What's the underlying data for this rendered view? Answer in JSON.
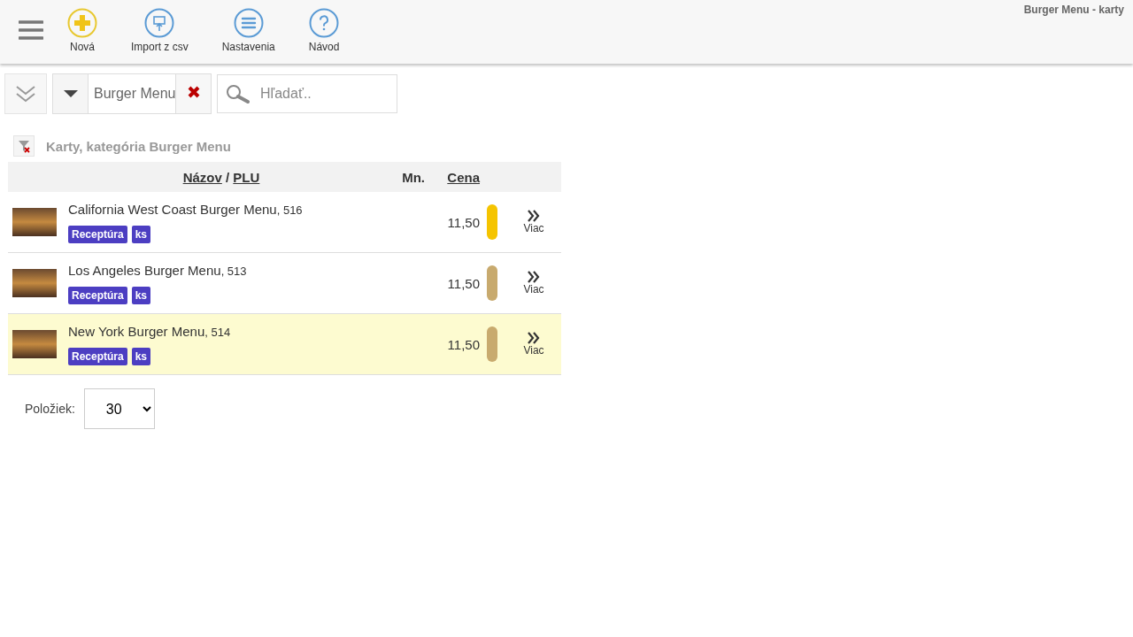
{
  "window": {
    "title": "Burger Menu - karty"
  },
  "toolbar": [
    {
      "kind": "add",
      "label": "Nová"
    },
    {
      "kind": "import",
      "label": "Import z csv"
    },
    {
      "kind": "settings",
      "label": "Nastavenia"
    },
    {
      "kind": "help",
      "label": "Návod"
    }
  ],
  "filter": {
    "category": "Burger Menu",
    "search_placeholder": "Hľadať.."
  },
  "heading": "Karty, kategória Burger Menu",
  "table": {
    "columns": {
      "name": "Názov",
      "separator": "/",
      "plu": "PLU",
      "qty": "Mn.",
      "price": "Cena"
    },
    "rows": [
      {
        "name": "California West Coast Burger Menu",
        "plu": ", 516",
        "tags": [
          "Receptúra",
          "ks"
        ],
        "price": "11,50",
        "color": "#f5c400",
        "more": "Viac",
        "highlighted": false
      },
      {
        "name": "Los Angeles Burger Menu",
        "plu": ", 513",
        "tags": [
          "Receptúra",
          "ks"
        ],
        "price": "11,50",
        "color": "#c8aa6e",
        "more": "Viac",
        "highlighted": false
      },
      {
        "name": "New York Burger Menu",
        "plu": ", 514",
        "tags": [
          "Receptúra",
          "ks"
        ],
        "price": "11,50",
        "color": "#c8aa6e",
        "more": "Viac",
        "highlighted": true
      }
    ]
  },
  "pager": {
    "label": "Položiek:",
    "value": "30"
  }
}
